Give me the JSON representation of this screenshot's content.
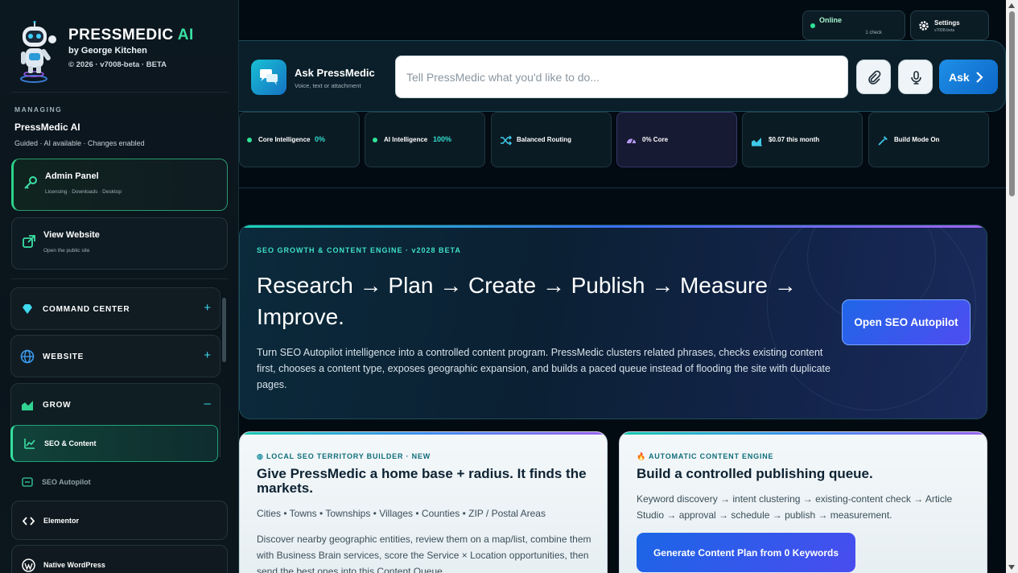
{
  "brand": {
    "title": "PRESSMEDIC",
    "title_ai": "AI",
    "byline": "by George Kitchen",
    "version": "© 2026 · v7008-beta · BETA"
  },
  "managing": {
    "label": "MANAGING",
    "name": "PressMedic AI",
    "desc": "Guided · AI available · Changes enabled"
  },
  "sidebar_cards": [
    {
      "title": "Admin Panel",
      "sub": "Licensing · Downloads · Desktop",
      "icon": "key-icon"
    },
    {
      "title": "View Website",
      "sub": "Open the public site",
      "icon": "external-link-icon"
    }
  ],
  "nav": {
    "groups": [
      {
        "label": "COMMAND CENTER",
        "toggle": "+",
        "icon": "diamond-icon"
      },
      {
        "label": "WEBSITE",
        "toggle": "+",
        "icon": "globe-icon"
      },
      {
        "label": "GROW",
        "toggle": "–",
        "icon": "chart-icon"
      }
    ],
    "sub_items": [
      {
        "label": "SEO & Content",
        "icon": "line-chart-icon"
      },
      {
        "label": "SEO Autopilot",
        "icon": "autopilot-icon"
      }
    ]
  },
  "bottom_items": [
    {
      "label": "Elementor",
      "icon": "code-icon"
    },
    {
      "label": "Native WordPress",
      "icon": "wordpress-icon"
    }
  ],
  "top_status": {
    "online": "Online",
    "online_sub": "1 check",
    "settings": "Settings",
    "settings_sub": "v7008-beta"
  },
  "ask": {
    "title": "Ask PressMedic",
    "sub": "Voice, text or attachment",
    "placeholder": "Tell PressMedic what you'd like to do...",
    "button": "Ask"
  },
  "stats": [
    {
      "label": "Core Intelligence",
      "value": "0%"
    },
    {
      "label": "AI Intelligence",
      "value": "100%"
    },
    {
      "label": "Balanced Routing",
      "value": ""
    },
    {
      "label": "0% Core",
      "value": ""
    },
    {
      "label": "$0.07 this month",
      "value": ""
    },
    {
      "label": "Build Mode On",
      "value": ""
    }
  ],
  "hero": {
    "tag": "SEO GROWTH & CONTENT ENGINE · v2028 BETA",
    "headline": "Research → Plan → Create → Publish → Measure → Improve.",
    "body": "Turn SEO Autopilot intelligence into a controlled content program. PressMedic clusters related phrases, checks existing content first, chooses a content type, exposes geographic expansion, and builds a paced queue instead of flooding the site with duplicate pages.",
    "button": "Open SEO Autopilot"
  },
  "card_local": {
    "tag": "LOCAL SEO TERRITORY BUILDER · NEW",
    "headline": "Give PressMedic a home base + radius. It finds the markets.",
    "meta": "Cities • Towns • Townships • Villages • Counties • ZIP / Postal Areas",
    "body": "Discover nearby geographic entities, review them on a map/list, combine them with Business Brain services, score the Service × Location opportunities, then send the best ones into this Content Queue."
  },
  "card_engine": {
    "tag": "AUTOMATIC CONTENT ENGINE",
    "headline": "Build a controlled publishing queue.",
    "body": "Keyword discovery → intent clustering → existing-content check → Article Studio → approval → schedule → publish → measurement.",
    "button": "Generate Content Plan from 0 Keywords"
  },
  "colors": {
    "accent_green": "#2fe397",
    "accent_cyan": "#3fe0c8",
    "primary_blue": "#1e8fe6",
    "purple": "#4f4cf0"
  }
}
